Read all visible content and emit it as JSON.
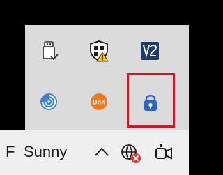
{
  "taskbar": {
    "weather_fragment": "F",
    "weather_condition": "Sunny"
  },
  "tray_overflow": {
    "icons": [
      {
        "name": "usb-drive-icon"
      },
      {
        "name": "windows-security-icon"
      },
      {
        "name": "veracrypt-icon"
      },
      {
        "name": "sync-swirl-icon"
      },
      {
        "name": "dnx-app-icon",
        "label": "DnX"
      },
      {
        "name": "lock-app-icon"
      }
    ]
  },
  "colors": {
    "highlight": "#e0101b",
    "flyout_bg": "#dbdbdb",
    "taskbar_bg": "#efefef"
  }
}
